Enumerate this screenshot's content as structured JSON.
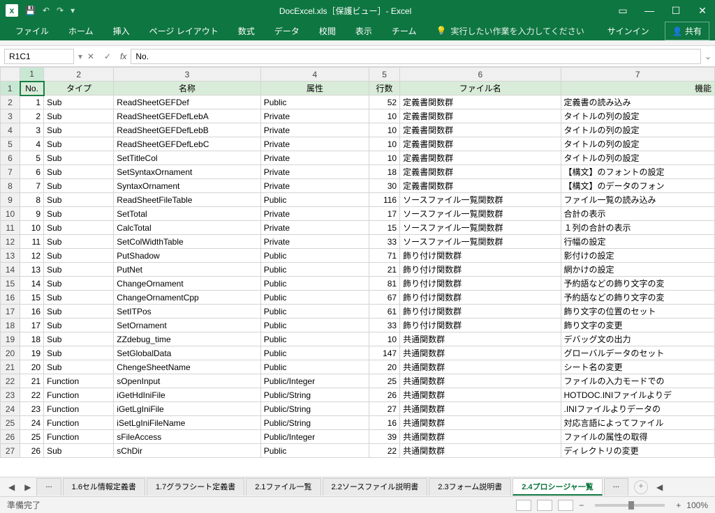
{
  "titlebar": {
    "title": "DocExcel.xls［保護ビュー］- Excel"
  },
  "ribbon": {
    "tabs": [
      "ファイル",
      "ホーム",
      "挿入",
      "ページ レイアウト",
      "数式",
      "データ",
      "校閲",
      "表示",
      "チーム"
    ],
    "tellme": "実行したい作業を入力してください",
    "signin": "サインイン",
    "share": "共有"
  },
  "formula": {
    "namebox": "R1C1",
    "value": "No."
  },
  "colLetters": [
    "1",
    "2",
    "3",
    "4",
    "5",
    "6",
    "7"
  ],
  "headers": [
    "No.",
    "タイプ",
    "名称",
    "属性",
    "行数",
    "ファイル名",
    "機能"
  ],
  "rows": [
    {
      "n": 1,
      "no": 1,
      "type": "Sub",
      "name": "ReadSheetGEFDef",
      "attr": "Public",
      "lines": 52,
      "file": "定義書関数群",
      "func": "定義書の読み込み"
    },
    {
      "n": 2,
      "no": 2,
      "type": "Sub",
      "name": "ReadSheetGEFDefLebA",
      "attr": "Private",
      "lines": 10,
      "file": "定義書関数群",
      "func": "タイトルの列の設定"
    },
    {
      "n": 3,
      "no": 3,
      "type": "Sub",
      "name": "ReadSheetGEFDefLebB",
      "attr": "Private",
      "lines": 10,
      "file": "定義書関数群",
      "func": "タイトルの列の設定"
    },
    {
      "n": 4,
      "no": 4,
      "type": "Sub",
      "name": "ReadSheetGEFDefLebC",
      "attr": "Private",
      "lines": 10,
      "file": "定義書関数群",
      "func": "タイトルの列の設定"
    },
    {
      "n": 5,
      "no": 5,
      "type": "Sub",
      "name": "SetTitleCol",
      "attr": "Private",
      "lines": 10,
      "file": "定義書関数群",
      "func": "タイトルの列の設定"
    },
    {
      "n": 6,
      "no": 6,
      "type": "Sub",
      "name": "SetSyntaxOrnament",
      "attr": "Private",
      "lines": 18,
      "file": "定義書関数群",
      "func": "【構文】のフォントの設定"
    },
    {
      "n": 7,
      "no": 7,
      "type": "Sub",
      "name": "SyntaxOrnament",
      "attr": "Private",
      "lines": 30,
      "file": "定義書関数群",
      "func": "【構文】のデータのフォン"
    },
    {
      "n": 8,
      "no": 8,
      "type": "Sub",
      "name": "ReadSheetFileTable",
      "attr": "Public",
      "lines": 116,
      "file": "ソースファイル一覧関数群",
      "func": "ファイル一覧の読み込み"
    },
    {
      "n": 9,
      "no": 9,
      "type": "Sub",
      "name": "SetTotal",
      "attr": "Private",
      "lines": 17,
      "file": "ソースファイル一覧関数群",
      "func": "合計の表示"
    },
    {
      "n": 10,
      "no": 10,
      "type": "Sub",
      "name": "CalcTotal",
      "attr": "Private",
      "lines": 15,
      "file": "ソースファイル一覧関数群",
      "func": "１列の合計の表示"
    },
    {
      "n": 11,
      "no": 11,
      "type": "Sub",
      "name": "SetColWidthTable",
      "attr": "Private",
      "lines": 33,
      "file": "ソースファイル一覧関数群",
      "func": "行幅の設定"
    },
    {
      "n": 12,
      "no": 12,
      "type": "Sub",
      "name": "PutShadow",
      "attr": "Public",
      "lines": 71,
      "file": "飾り付け関数群",
      "func": "影付けの設定"
    },
    {
      "n": 13,
      "no": 13,
      "type": "Sub",
      "name": "PutNet",
      "attr": "Public",
      "lines": 21,
      "file": "飾り付け関数群",
      "func": "網かけの設定"
    },
    {
      "n": 14,
      "no": 14,
      "type": "Sub",
      "name": "ChangeOrnament",
      "attr": "Public",
      "lines": 81,
      "file": "飾り付け関数群",
      "func": "予約語などの飾り文字の変"
    },
    {
      "n": 15,
      "no": 15,
      "type": "Sub",
      "name": "ChangeOrnamentCpp",
      "attr": "Public",
      "lines": 67,
      "file": "飾り付け関数群",
      "func": "予約語などの飾り文字の変"
    },
    {
      "n": 16,
      "no": 16,
      "type": "Sub",
      "name": "SetITPos",
      "attr": "Public",
      "lines": 61,
      "file": "飾り付け関数群",
      "func": "飾り文字の位置のセット"
    },
    {
      "n": 17,
      "no": 17,
      "type": "Sub",
      "name": "SetOrnament",
      "attr": "Public",
      "lines": 33,
      "file": "飾り付け関数群",
      "func": "飾り文字の変更"
    },
    {
      "n": 18,
      "no": 18,
      "type": "Sub",
      "name": "ZZdebug_time",
      "attr": "Public",
      "lines": 10,
      "file": "共通関数群",
      "func": "デバッグ文の出力"
    },
    {
      "n": 19,
      "no": 19,
      "type": "Sub",
      "name": "SetGlobalData",
      "attr": "Public",
      "lines": 147,
      "file": "共通関数群",
      "func": "グローバルデータのセット"
    },
    {
      "n": 20,
      "no": 20,
      "type": "Sub",
      "name": "ChengeSheetName",
      "attr": "Public",
      "lines": 20,
      "file": "共通関数群",
      "func": "シート名の変更"
    },
    {
      "n": 21,
      "no": 21,
      "type": "Function",
      "name": "sOpenInput",
      "attr": "Public/Integer",
      "lines": 25,
      "file": "共通関数群",
      "func": "ファイルの入力モードでの"
    },
    {
      "n": 22,
      "no": 22,
      "type": "Function",
      "name": "iGetHdIniFile",
      "attr": "Public/String",
      "lines": 26,
      "file": "共通関数群",
      "func": "HOTDOC.INIファイルよりデ"
    },
    {
      "n": 23,
      "no": 23,
      "type": "Function",
      "name": "iGetLgIniFile",
      "attr": "Public/String",
      "lines": 27,
      "file": "共通関数群",
      "func": ".INIファイルよりデータの"
    },
    {
      "n": 24,
      "no": 24,
      "type": "Function",
      "name": "iSetLgIniFileName",
      "attr": "Public/String",
      "lines": 16,
      "file": "共通関数群",
      "func": "対応言語によってファイル"
    },
    {
      "n": 25,
      "no": 25,
      "type": "Function",
      "name": "sFileAccess",
      "attr": "Public/Integer",
      "lines": 39,
      "file": "共通関数群",
      "func": "ファイルの属性の取得"
    },
    {
      "n": 26,
      "no": 26,
      "type": "Sub",
      "name": "sChDir",
      "attr": "Public",
      "lines": 22,
      "file": "共通関数群",
      "func": "ディレクトリの変更"
    }
  ],
  "sheets": {
    "tabs": [
      "...",
      "1.6セル情報定義書",
      "1.7グラフシート定義書",
      "2.1ファイル一覧",
      "2.2ソースファイル説明書",
      "2.3フォーム説明書",
      "2.4プロシージャ一覧",
      "..."
    ],
    "active": "2.4プロシージャ一覧"
  },
  "status": {
    "ready": "準備完了",
    "zoom": "100%"
  }
}
